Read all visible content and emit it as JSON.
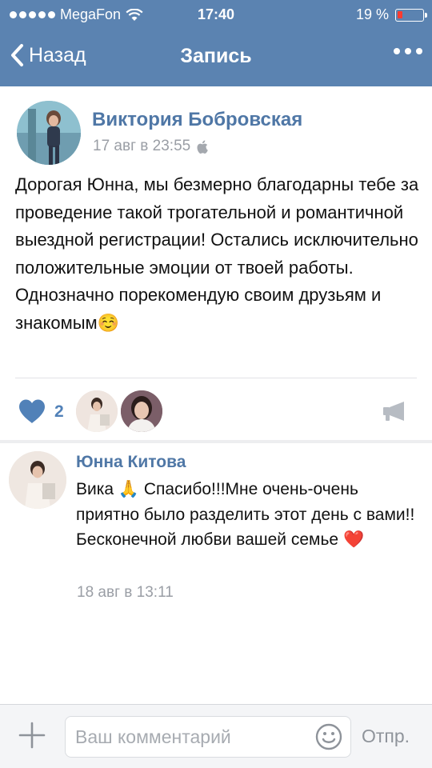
{
  "status_bar": {
    "carrier": "MegaFon",
    "time": "17:40",
    "battery_text": "19 %",
    "battery_level": 0.19
  },
  "nav": {
    "back_label": "Назад",
    "title": "Запись"
  },
  "post": {
    "author": "Виктория Бобровская",
    "date": "17 авг в 23:55",
    "text": "Дорогая Юнна, мы безмерно благодарны тебе за проведение такой трогательной и романтичной выездной регистрации! Остались исключительно положительные эмоции от твоей работы. Однозначно порекомендую своим друзьям и знакомым☺️",
    "likes_count": "2"
  },
  "comment": {
    "author": "Юнна Китова",
    "text": "Вика 🙏 Спасибо!!!Мне очень-очень приятно было разделить этот день с вами!! Бесконечной любви вашей семье ❤️",
    "date": "18 авг в 13:11"
  },
  "composer": {
    "placeholder": "Ваш комментарий",
    "send_label": "Отпр."
  },
  "icons": {
    "back": "chevron-left-icon",
    "more": "more-dots-icon",
    "device": "apple-icon",
    "like": "heart-icon",
    "share": "megaphone-icon",
    "attach": "plus-icon",
    "emoji": "smile-icon"
  },
  "colors": {
    "header": "#5b83b1",
    "link": "#4f77a6",
    "like": "#5181b8",
    "battery_low": "#ff3b30"
  }
}
